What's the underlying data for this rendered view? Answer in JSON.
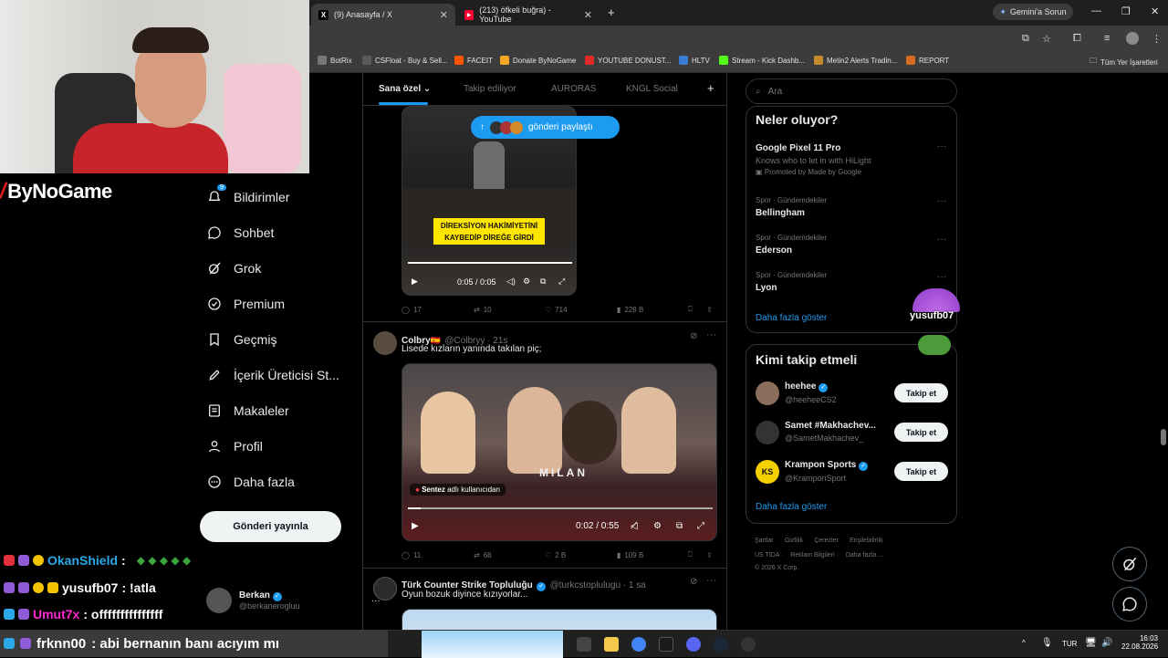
{
  "browser": {
    "tabs": [
      {
        "label": "(9) Anasayfa / X",
        "icon": "x-logo-icon"
      },
      {
        "label": "(213) öfkeli buğra) - YouTube",
        "icon": "youtube-icon"
      }
    ],
    "gemini_label": "Gemini'a Sorun",
    "bookmarks": [
      "BotRix",
      "CSFloat - Buy & Sell...",
      "FACEIT",
      "Donate ByNoGame",
      "YOUTUBE DONUST...",
      "HLTV",
      "Stream - Kick Dashb...",
      "Metin2 Alerts Tradin...",
      "REPORT"
    ],
    "all_bookmarks": "Tüm Yer İşaretleri"
  },
  "stream": {
    "logo": "ByNoGame",
    "chat": [
      {
        "user": "OkanShield",
        "msg": ":",
        "color": "#2aa8e8"
      },
      {
        "user": "yusufb07",
        "msg": ": !atla",
        "color": "#ffffff"
      },
      {
        "user": "Umut7x",
        "msg": ": offfffffffffffff",
        "color": "#ff2bd0"
      },
      {
        "user": "frknn00",
        "msg": ": abi bernanın banı acıyım mı",
        "color": "#ffffff"
      }
    ],
    "overlay_user": "yusufb07"
  },
  "sidebar": {
    "items": [
      {
        "label": "Bildirimler",
        "icon": "bell-icon",
        "badge": "9"
      },
      {
        "label": "Sohbet",
        "icon": "chat-icon"
      },
      {
        "label": "Grok",
        "icon": "grok-icon"
      },
      {
        "label": "Premium",
        "icon": "premium-icon"
      },
      {
        "label": "Geçmiş",
        "icon": "bookmark-icon"
      },
      {
        "label": "İçerik Üreticisi St...",
        "icon": "rocket-icon"
      },
      {
        "label": "Makaleler",
        "icon": "article-icon"
      },
      {
        "label": "Profil",
        "icon": "person-icon"
      },
      {
        "label": "Daha fazla",
        "icon": "more-circle-icon"
      }
    ],
    "post_button": "Gönderi yayınla",
    "account": {
      "name": "Berkan",
      "handle": "@berkanerogluu",
      "more": "···"
    }
  },
  "feed": {
    "tabs": [
      "Sana özel",
      "Takip ediliyor",
      "AURORAS",
      "KNGL Social"
    ],
    "share_pill": "gönderi paylaştı",
    "post1": {
      "caption": "DİREKSİYON HAKİMİYETİNİ KAYBEDİP DİREĞE GİRDİ",
      "time": "0:05 / 0:05",
      "replies": "17",
      "reposts": "10",
      "likes": "714",
      "views": "228 B"
    },
    "post2": {
      "name": "Colbry",
      "handle": "@Colbryy · 21s",
      "text": "Lisede kızların yanında takılan piç;",
      "user_tag": "Sentez",
      "user_tag_suffix": "adlı kullanıcıdan",
      "time": "0:02 / 0:55",
      "replies": "11",
      "reposts": "68",
      "likes": "2 B",
      "views": "109 B"
    },
    "post3": {
      "name": "Türk Counter Strike Topluluğu",
      "handle": "@turkcstoplulugu · 1 sa",
      "text": "Oyun bozuk diyince kızıyorlar..."
    }
  },
  "right": {
    "search_placeholder": "Ara",
    "trends_title": "Neler oluyor?",
    "promo": {
      "name": "Google Pixel 11 Pro",
      "desc": "Knows who to let in with HiLight",
      "by": "Promoted by Made by Google"
    },
    "trends": [
      {
        "cat": "Spor · Gündemdekiler",
        "name": "Bellingham"
      },
      {
        "cat": "Spor · Gündemdekiler",
        "name": "Ederson"
      },
      {
        "cat": "Spor · Gündemdekiler",
        "name": "Lyon"
      }
    ],
    "show_more": "Daha fazla göster",
    "who_title": "Kimi takip etmeli",
    "who": [
      {
        "name": "heehee",
        "handle": "@heeheeCS2"
      },
      {
        "name": "Samet #Makhachev...",
        "handle": "@SametMakhachev_"
      },
      {
        "name": "Krampon Sports",
        "handle": "@KramponSport"
      }
    ],
    "follow_label": "Takip et",
    "footer1": [
      "Şartlar",
      "Gizlilik",
      "Çerezler",
      "Erişilebilirlik"
    ],
    "footer2": [
      "US TIDA",
      "Reklam Bilgileri",
      "Daha fazla ..."
    ],
    "copyright": "© 2026 X Corp."
  },
  "taskbar": {
    "lang": "TUR",
    "time": "16:03",
    "date": "22.08.2026"
  }
}
